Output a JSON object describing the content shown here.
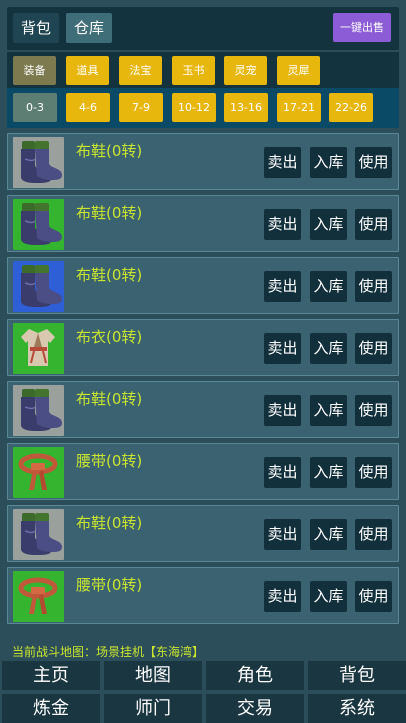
{
  "top_tabs": [
    {
      "label": "背包",
      "active": false
    },
    {
      "label": "仓库",
      "active": true
    }
  ],
  "sell_all_label": "一键出售",
  "categories": [
    {
      "label": "装备",
      "active": true
    },
    {
      "label": "道具",
      "active": false
    },
    {
      "label": "法宝",
      "active": false
    },
    {
      "label": "玉书",
      "active": false
    },
    {
      "label": "灵宠",
      "active": false
    },
    {
      "label": "灵犀",
      "active": false
    }
  ],
  "levels": [
    {
      "label": "0-3",
      "active": true
    },
    {
      "label": "4-6",
      "active": false
    },
    {
      "label": "7-9",
      "active": false
    },
    {
      "label": "10-12",
      "active": false
    },
    {
      "label": "13-16",
      "active": false
    },
    {
      "label": "17-21",
      "active": false
    },
    {
      "label": "22-26",
      "active": false
    }
  ],
  "item_actions": {
    "sell": "卖出",
    "store": "入库",
    "use": "使用"
  },
  "items": [
    {
      "name": "布鞋(0转)",
      "icon": "boots-icon",
      "bg": "#9aa09c"
    },
    {
      "name": "布鞋(0转)",
      "icon": "boots-icon",
      "bg": "#35b52f"
    },
    {
      "name": "布鞋(0转)",
      "icon": "boots-icon",
      "bg": "#2f5fd6"
    },
    {
      "name": "布衣(0转)",
      "icon": "robe-icon",
      "bg": "#35b52f"
    },
    {
      "name": "布鞋(0转)",
      "icon": "boots-icon",
      "bg": "#9aa09c"
    },
    {
      "name": "腰带(0转)",
      "icon": "belt-icon",
      "bg": "#35b52f"
    },
    {
      "name": "布鞋(0转)",
      "icon": "boots-icon",
      "bg": "#9aa09c"
    },
    {
      "name": "腰带(0转)",
      "icon": "belt-icon",
      "bg": "#35b52f"
    }
  ],
  "status_text": "当前战斗地图：场景挂机【东海湾】",
  "bottom_nav": [
    [
      "主页",
      "地图",
      "角色",
      "背包"
    ],
    [
      "炼金",
      "师门",
      "交易",
      "系统"
    ]
  ]
}
